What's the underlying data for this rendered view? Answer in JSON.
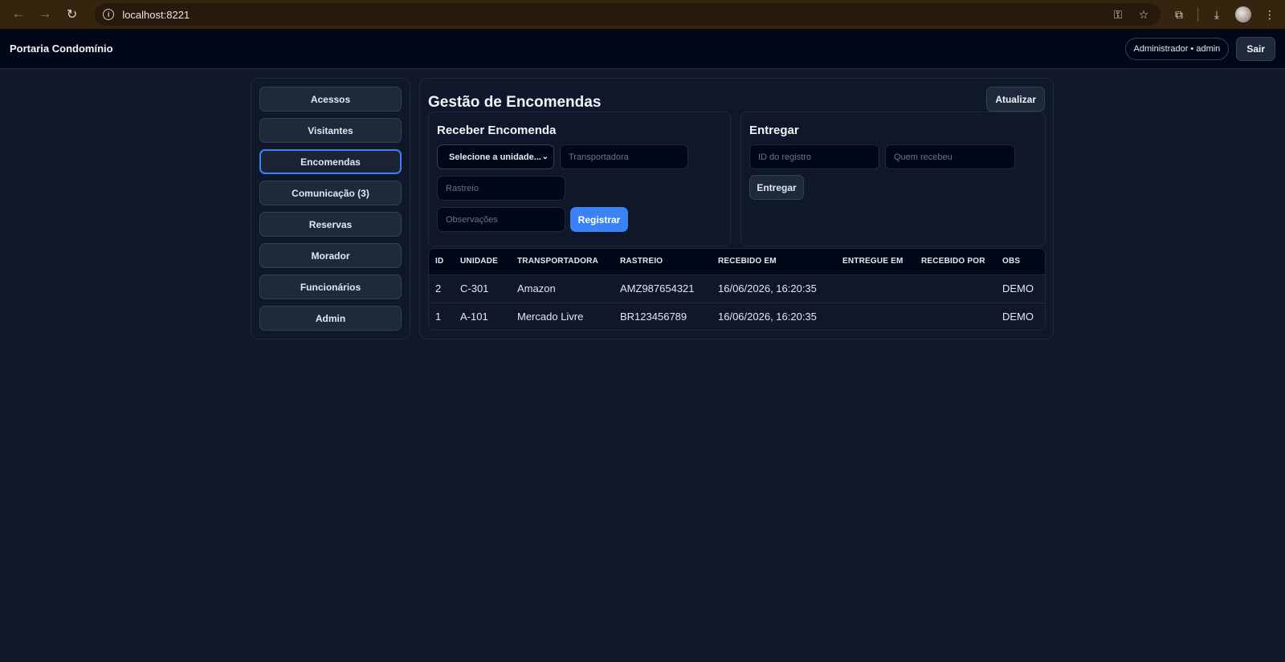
{
  "browser": {
    "url": "localhost:8221"
  },
  "header": {
    "brand": "Portaria Condomínio",
    "user": "Administrador • admin",
    "logout_label": "Sair"
  },
  "sidebar": {
    "items": [
      {
        "label": "Acessos"
      },
      {
        "label": "Visitantes"
      },
      {
        "label": "Encomendas"
      },
      {
        "label": "Comunicação (3)"
      },
      {
        "label": "Reservas"
      },
      {
        "label": "Morador"
      },
      {
        "label": "Funcionários"
      },
      {
        "label": "Admin"
      }
    ],
    "active_index": 2
  },
  "page": {
    "title": "Gestão de Encomendas",
    "refresh_label": "Atualizar"
  },
  "receber": {
    "title": "Receber Encomenda",
    "unit_select": "Selecione a unidade...",
    "carrier_placeholder": "Transportadora",
    "tracking_placeholder": "Rastreio",
    "notes_placeholder": "Observações",
    "submit_label": "Registrar"
  },
  "entregar": {
    "title": "Entregar",
    "id_placeholder": "ID do registro",
    "receiver_placeholder": "Quem recebeu",
    "submit_label": "Entregar"
  },
  "table": {
    "headers": [
      "ID",
      "UNIDADE",
      "TRANSPORTADORA",
      "RASTREIO",
      "RECEBIDO EM",
      "ENTREGUE EM",
      "RECEBIDO POR",
      "OBS"
    ],
    "rows": [
      [
        "2",
        "C-301",
        "Amazon",
        "AMZ987654321",
        "16/06/2026, 16:20:35",
        "",
        "",
        "DEMO"
      ],
      [
        "1",
        "A-101",
        "Mercado Livre",
        "BR123456789",
        "16/06/2026, 16:20:35",
        "",
        "",
        "DEMO"
      ]
    ]
  }
}
